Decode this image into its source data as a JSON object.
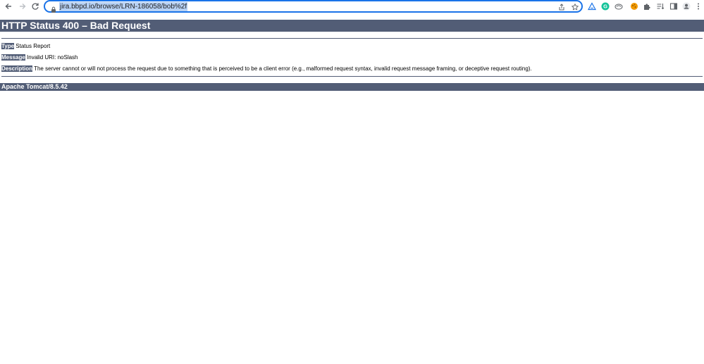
{
  "browser": {
    "url": "jira.bbpd.io/browse/LRN-186058/bob%2f",
    "icons": [
      "back-icon",
      "forward-icon",
      "reload-icon",
      "lock-icon",
      "share-icon",
      "bookmark-star-icon",
      "extension-triangle-icon",
      "grammarly-icon",
      "extension-cloud-icon",
      "extension-cookie-icon",
      "puzzle-extensions-icon",
      "reading-list-icon",
      "side-panel-icon",
      "profile-avatar-icon",
      "menu-kebab-icon"
    ]
  },
  "page": {
    "title": "HTTP Status 400 – Bad Request",
    "type_label": "Type",
    "type_value": " Status Report",
    "message_label": "Message",
    "message_value": " Invalid URI: noSlash",
    "description_label": "Description",
    "description_value": " The server cannot or will not process the request due to something that is perceived to be a client error (e.g., malformed request syntax, invalid request message framing, or deceptive request routing).",
    "footer": "Apache Tomcat/8.5.42"
  },
  "colors": {
    "tomcat_header": "#525d76",
    "omnibox_border": "#1a73e8",
    "url_highlight": "#b7d1f4"
  }
}
